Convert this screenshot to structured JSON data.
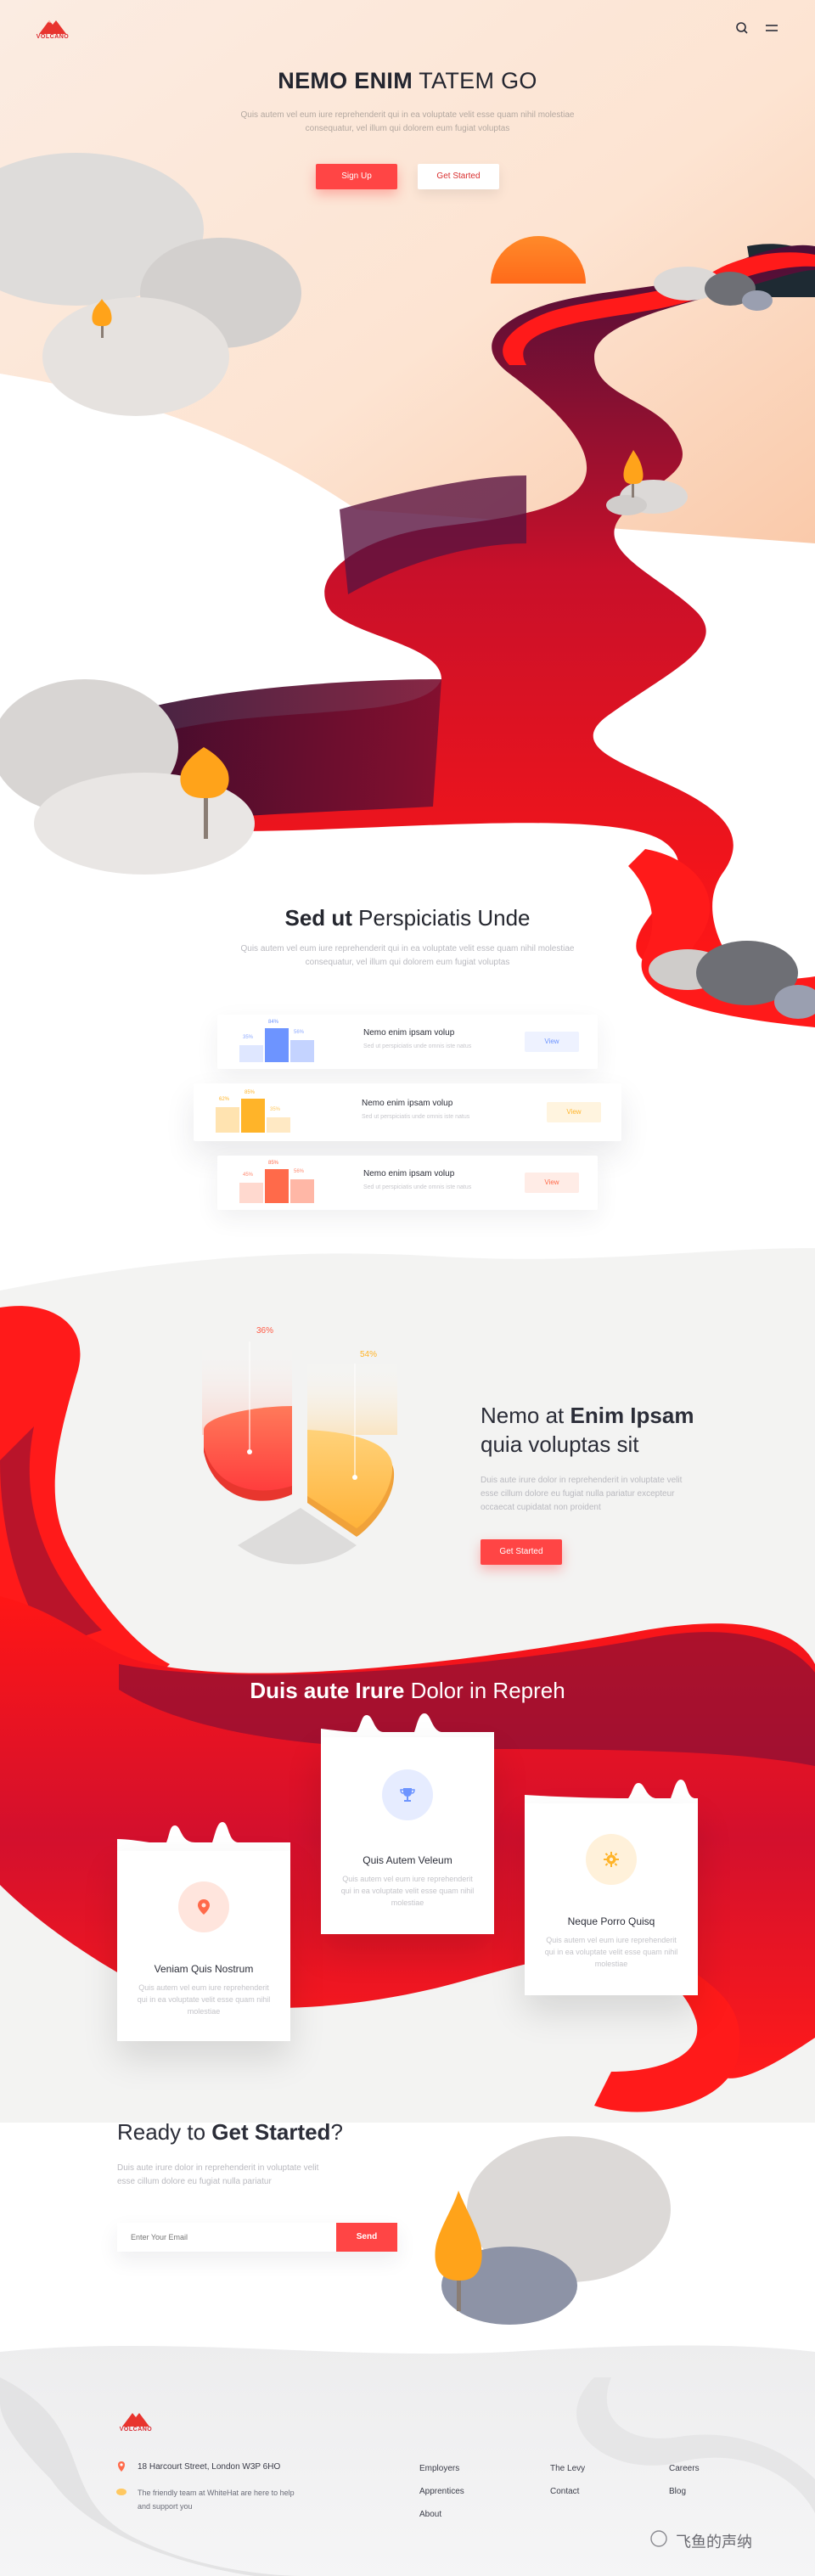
{
  "brand": {
    "name": "VOLCANO"
  },
  "nav": {
    "search_icon": "search-icon",
    "menu_icon": "hamburger-menu-icon"
  },
  "hero": {
    "title_bold": "NEMO ENIM",
    "title_light": " TATEM GO",
    "subtitle": "Quis autem vel eum iure reprehenderit qui in ea voluptate velit esse quam nihil molestiae consequatur, vel illum qui dolorem eum fugiat voluptas",
    "btn_signup": "Sign Up",
    "btn_started": "Get Started"
  },
  "features": {
    "title_bold": "Sed ut",
    "title_light": " Perspiciatis Unde",
    "subtitle": "Quis autem vel eum iure reprehenderit qui in ea voluptate velit esse quam nihil molestiae consequatur, vel illum qui dolorem eum fugiat voluptas",
    "cards": [
      {
        "title": "Nemo enim ipsam volup",
        "sub": "Sed ut perspiciatis unde omnis iste natus",
        "button": "View",
        "color": "#6d94ff",
        "labels": [
          "35%",
          "84%",
          "56%"
        ]
      },
      {
        "title": "Nemo enim ipsam volup",
        "sub": "Sed ut perspiciatis unde omnis iste natus",
        "button": "View",
        "color": "#ffb429",
        "labels": [
          "62%",
          "85%",
          "35%"
        ]
      },
      {
        "title": "Nemo enim ipsam volup",
        "sub": "Sed ut perspiciatis unde omnis iste natus",
        "button": "View",
        "color": "#ff6a4a",
        "labels": [
          "45%",
          "85%",
          "56%"
        ]
      }
    ]
  },
  "stats": {
    "labels": [
      "36%",
      "54%"
    ],
    "title_light1": "Nemo at ",
    "title_bold": "Enim Ipsam",
    "title_light2": "quia voluptas sit",
    "desc": "Duis aute irure dolor in reprehenderit in voluptate velit esse cillum dolore eu fugiat nulla pariatur excepteur occaecat cupidatat non proident",
    "button": "Get Started"
  },
  "services": {
    "title_bold": "Duis aute Irure",
    "title_light": " Dolor in Repreh",
    "cards": [
      {
        "title": "Veniam Quis Nostrum",
        "desc": "Quis autem vel eum iure reprehenderit qui in ea voluptate velit esse quam nihil molestiae",
        "icon": "location-pin-icon",
        "color": "#ff6a4a"
      },
      {
        "title": "Quis Autem Veleum",
        "desc": "Quis autem vel eum iure reprehenderit qui in ea voluptate velit esse quam nihil molestiae",
        "icon": "trophy-icon",
        "color": "#6d94ff"
      },
      {
        "title": "Neque Porro Quisq",
        "desc": "Quis autem vel eum iure reprehenderit qui in ea voluptate velit esse quam nihil molestiae",
        "icon": "gear-icon",
        "color": "#ffb429"
      }
    ]
  },
  "cta": {
    "title_light": "Ready to ",
    "title_bold": "Get Started",
    "title_end": "?",
    "desc": "Duis aute irure dolor in reprehenderit in voluptate velit esse cillum dolore eu fugiat nulla pariatur",
    "email_placeholder": "Enter Your Email",
    "send": "Send"
  },
  "footer": {
    "address": "18 Harcourt Street, London W3P 6HO",
    "tagline": "The friendly team at WhiteHat are here to help and support you",
    "col1": [
      "Employers",
      "Apprentices",
      "About"
    ],
    "col2": [
      "The Levy",
      "Contact"
    ],
    "col3": [
      "Careers",
      "Blog"
    ],
    "watermark": "飞鱼的声纳"
  },
  "colors": {
    "accent": "#ff4545",
    "lava": "#ff1a1a",
    "dark": "#3a0e2e",
    "orange": "#ffa31a"
  }
}
